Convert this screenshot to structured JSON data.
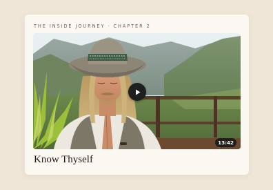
{
  "card": {
    "series": "THE INSIDE JOURNEY",
    "separator": "·",
    "chapter": "CHAPTER 2",
    "title": "Know Thyself"
  },
  "video": {
    "duration": "13:42",
    "play_icon": "play-icon",
    "scene": "person-meditating-mountain-landscape"
  },
  "colors": {
    "page_background": "#efe6d8",
    "card_background": "#fbf8f1",
    "eyebrow_text": "#6a6258",
    "title_text": "#1e1b17",
    "play_button": "#1f1f1f"
  }
}
